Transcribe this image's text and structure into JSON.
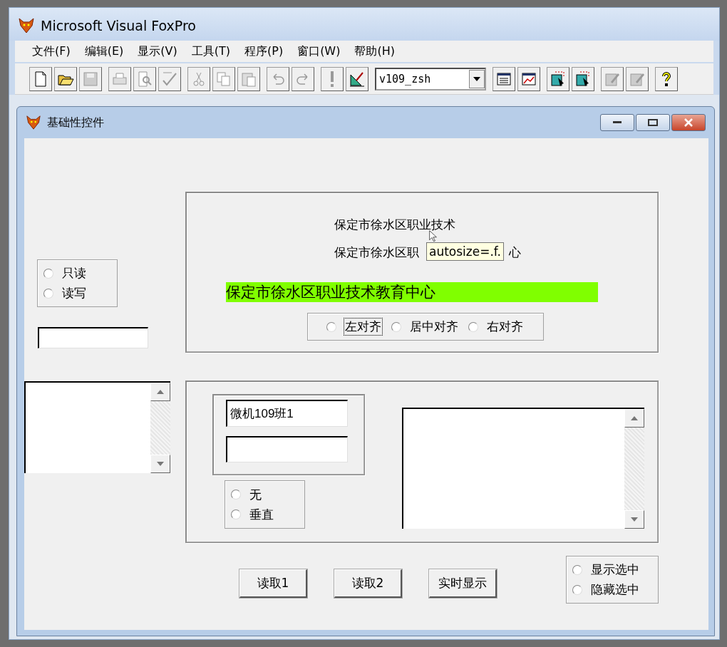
{
  "app": {
    "title": "Microsoft Visual FoxPro"
  },
  "menu": [
    {
      "label": "文件(F)"
    },
    {
      "label": "编辑(E)"
    },
    {
      "label": "显示(V)"
    },
    {
      "label": "工具(T)"
    },
    {
      "label": "程序(P)"
    },
    {
      "label": "窗口(W)"
    },
    {
      "label": "帮助(H)"
    }
  ],
  "toolbar": [
    [
      {
        "kind": "new",
        "disabled": false
      },
      {
        "kind": "open",
        "disabled": false
      },
      {
        "kind": "save",
        "disabled": true
      }
    ],
    [
      {
        "kind": "print",
        "disabled": true
      },
      {
        "kind": "preview",
        "disabled": true
      },
      {
        "kind": "spell",
        "disabled": true
      }
    ],
    [
      {
        "kind": "cut",
        "disabled": true
      },
      {
        "kind": "copy",
        "disabled": true
      },
      {
        "kind": "paste",
        "disabled": true
      }
    ],
    [
      {
        "kind": "undo",
        "disabled": true
      },
      {
        "kind": "redo",
        "disabled": true
      }
    ],
    [
      {
        "kind": "run",
        "disabled": true
      },
      {
        "kind": "design",
        "disabled": false
      }
    ],
    [
      {
        "kind": "combo",
        "value": "v109_zsh"
      }
    ],
    [
      {
        "kind": "window",
        "disabled": false
      },
      {
        "kind": "chart",
        "disabled": false
      }
    ],
    [
      {
        "kind": "report",
        "disabled": false
      },
      {
        "kind": "report",
        "disabled": false
      }
    ],
    [
      {
        "kind": "edit",
        "disabled": true
      },
      {
        "kind": "edit",
        "disabled": true
      }
    ],
    [
      {
        "kind": "help",
        "disabled": false
      }
    ]
  ],
  "form": {
    "title": "基础性控件",
    "access_options": [
      {
        "label": "只读",
        "selected": false
      },
      {
        "label": "读写",
        "selected": false
      }
    ],
    "frame_top": {
      "label_1": "保定市徐水区职业技术",
      "label_2_parts": [
        "保定市徐水区职",
        "心"
      ],
      "tooltip": "autosize=.f.",
      "banner": "保定市徐水区职业技术教育中心",
      "align_options": [
        {
          "label": "左对齐",
          "selected": false,
          "focused": true
        },
        {
          "label": "居中对齐",
          "selected": false,
          "focused": false
        },
        {
          "label": "右对齐",
          "selected": false,
          "focused": false
        }
      ]
    },
    "frame_bottom": {
      "textbox_1": "微机109班1",
      "scroll_options": [
        {
          "label": "无",
          "selected": false
        },
        {
          "label": "垂直",
          "selected": false
        }
      ]
    },
    "buttons": [
      {
        "label": "读取1"
      },
      {
        "label": "读取2"
      },
      {
        "label": "实时显示"
      }
    ],
    "select_options": [
      {
        "label": "显示选中",
        "selected": false
      },
      {
        "label": "隐藏选中",
        "selected": false
      }
    ]
  }
}
